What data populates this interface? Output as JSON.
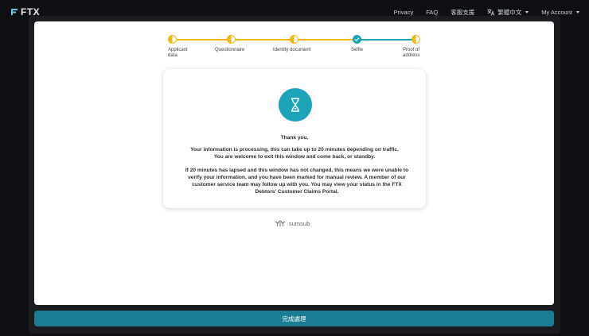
{
  "header": {
    "logo_text": "FTX",
    "nav": [
      "Privacy",
      "FAQ",
      "客服支援"
    ],
    "language": "繁體中文",
    "account": "My Account"
  },
  "stepper": {
    "steps": [
      {
        "label": "Applicant\ndata",
        "state": "in-progress"
      },
      {
        "label": "Questionnaire",
        "state": "in-progress"
      },
      {
        "label": "Identity document",
        "state": "in-progress"
      },
      {
        "label": "Selfie",
        "state": "complete"
      },
      {
        "label": "Proof of\naddress",
        "state": "in-progress"
      }
    ]
  },
  "status": {
    "icon": "hourglass-icon",
    "title": "Thank you.",
    "paragraph1": "Your information is processing, this can take up to 20 minutes depending on traffic. You are welcome to exit this window and come back, or standby.",
    "paragraph2": "If 20 minutes has lapsed and this window has not changed, this means we were unable to verify your information, and you have been marked for manual review. A member of our customer service team may follow up with you. You may view your status in the FTX Debtors' Customer Claims Portal."
  },
  "footer": {
    "brand": "sumsub"
  },
  "action": {
    "label": "完成處理"
  },
  "colors": {
    "accent": "#1ba3b7",
    "pending": "#f0b90b",
    "button": "#1b7d93"
  }
}
